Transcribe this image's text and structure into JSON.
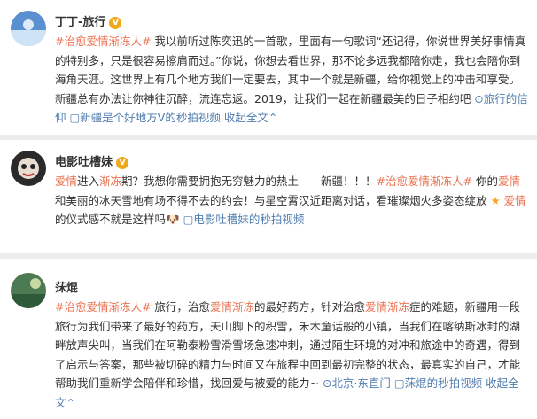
{
  "posts": [
    {
      "username": "丁丁-旅行",
      "badge": "V",
      "segments": [
        {
          "t": "#治愈爱情渐冻人#",
          "c": "link"
        },
        {
          "t": " 我以前听过陈奕迅的一首歌，里面有一句歌词“还记得，你说世界美好事情真的特别多，只是很容易擦肩而过。”你说，你想去看世界，那不论多远我都陪你走，我也会陪你到海角天涯。这世界上有几个地方我们一定要去，其中一个就是新疆，给你视觉上的冲击和享受。新疆总有办法让你神往沉醉，流连忘返。2019，让我们一起在新疆最美的日子相约吧 ",
          "c": ""
        },
        {
          "t": "⊙旅行的信仰 ",
          "c": "blue"
        },
        {
          "t": "▢新疆是个好地方V的秒拍视频 ",
          "c": "blue"
        },
        {
          "t": "收起全文",
          "c": "blue"
        },
        {
          "t": "⌃",
          "c": "blue"
        }
      ]
    },
    {
      "username": "电影吐槽妹",
      "badge": "V",
      "segments": [
        {
          "t": "爱情",
          "c": "link"
        },
        {
          "t": "进入",
          "c": ""
        },
        {
          "t": "渐冻",
          "c": "link"
        },
        {
          "t": "期？我想你需要拥抱无穷魅力的热土——新疆！！！",
          "c": ""
        },
        {
          "t": "#治愈爱情渐冻人#",
          "c": "link"
        },
        {
          "t": " 你的",
          "c": ""
        },
        {
          "t": "爱情",
          "c": "link"
        },
        {
          "t": "和美丽的冰天雪地有场不得不去的约会！与星空霄汉近距离对话，看璀璨烟火多姿态绽放 ",
          "c": ""
        },
        {
          "t": "★",
          "c": "star"
        },
        {
          "t": " 爱情",
          "c": "link"
        },
        {
          "t": "的仪式感不就是这样吗",
          "c": ""
        },
        {
          "t": "🐶",
          "c": "dog"
        },
        {
          "t": " ▢电影吐槽妹的秒拍视频",
          "c": "blue"
        }
      ]
    },
    {
      "username": "莯焜",
      "segments": [
        {
          "t": "#治愈爱情渐冻人#",
          "c": "link"
        },
        {
          "t": " 旅行，治愈",
          "c": ""
        },
        {
          "t": "爱情渐冻",
          "c": "link"
        },
        {
          "t": "的最好药方，针对治愈",
          "c": ""
        },
        {
          "t": "爱情渐冻",
          "c": "link"
        },
        {
          "t": "症的难题，新疆用一段旅行为我们带来了最好的药方，天山脚下的积雪，禾木童话般的小镇，当我们在喀纳斯冰封的湖畔放声尖叫，当我们在阿勒泰粉雪滑雪场急速冲刺，通过陌生环境的对冲和旅途中的奇遇，得到了启示与答案，那些被切碎的精力与时间又在旅程中回到最初完整的状态，最真实的自己，才能帮助我们重新学会陪伴和珍惜，找回爱与被爱的能力~ ",
          "c": ""
        },
        {
          "t": "⊙北京·东直门 ",
          "c": "blue"
        },
        {
          "t": "▢莯焜的秒拍视频 ",
          "c": "blue"
        },
        {
          "t": "收起全文",
          "c": "blue"
        },
        {
          "t": "⌃",
          "c": "blue"
        }
      ]
    }
  ]
}
